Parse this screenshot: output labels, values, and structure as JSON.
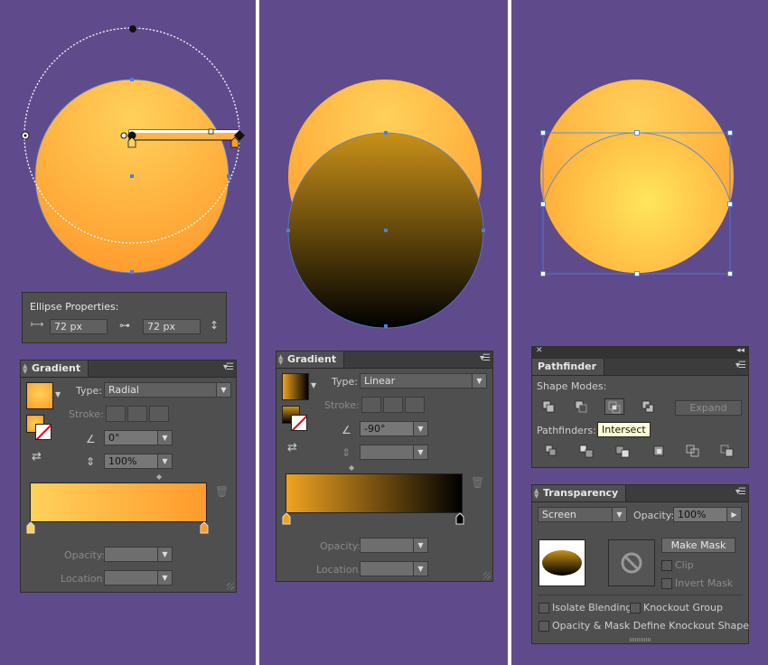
{
  "ellipse_properties": {
    "title": "Ellipse Properties:",
    "width_value": "72 px",
    "height_value": "72 px"
  },
  "gradient_radial": {
    "tab": "Gradient",
    "type_label": "Type:",
    "type_value": "Radial",
    "stroke_label": "Stroke:",
    "angle_value": "0°",
    "aspect_value": "100%",
    "opacity_label": "Opacity:",
    "location_label": "Location:",
    "gradient_colors": [
      "#ffd15a",
      "#ff9a2c"
    ]
  },
  "gradient_linear": {
    "tab": "Gradient",
    "type_label": "Type:",
    "type_value": "Linear",
    "stroke_label": "Stroke:",
    "angle_value": "-90°",
    "opacity_label": "Opacity:",
    "location_label": "Location:",
    "gradient_colors": [
      "#f0a320",
      "#000000"
    ]
  },
  "pathfinder": {
    "tab": "Pathfinder",
    "shape_modes_label": "Shape Modes:",
    "expand_label": "Expand",
    "pathfinders_label": "Pathfinders:",
    "tooltip": "Intersect"
  },
  "transparency": {
    "tab": "Transparency",
    "blend_mode": "Screen",
    "opacity_label": "Opacity:",
    "opacity_value": "100%",
    "make_mask_label": "Make Mask",
    "clip_label": "Clip",
    "invert_mask_label": "Invert Mask",
    "isolate_blending_label": "Isolate Blending",
    "knockout_group_label": "Knockout Group",
    "opacity_mask_label": "Opacity & Mask Define Knockout Shape"
  },
  "colors": {
    "background": "#5f4b8b",
    "panel": "#4f4f4f",
    "orange_light": "#ffd15a",
    "orange_dark": "#ff9a2c",
    "selection_blue": "#4a7fe0"
  },
  "icons": [
    "width-icon",
    "height-icon",
    "link-icon",
    "angle-icon",
    "aspect-ratio-icon",
    "trash-icon",
    "panel-menu-icon",
    "no-mask-icon"
  ]
}
